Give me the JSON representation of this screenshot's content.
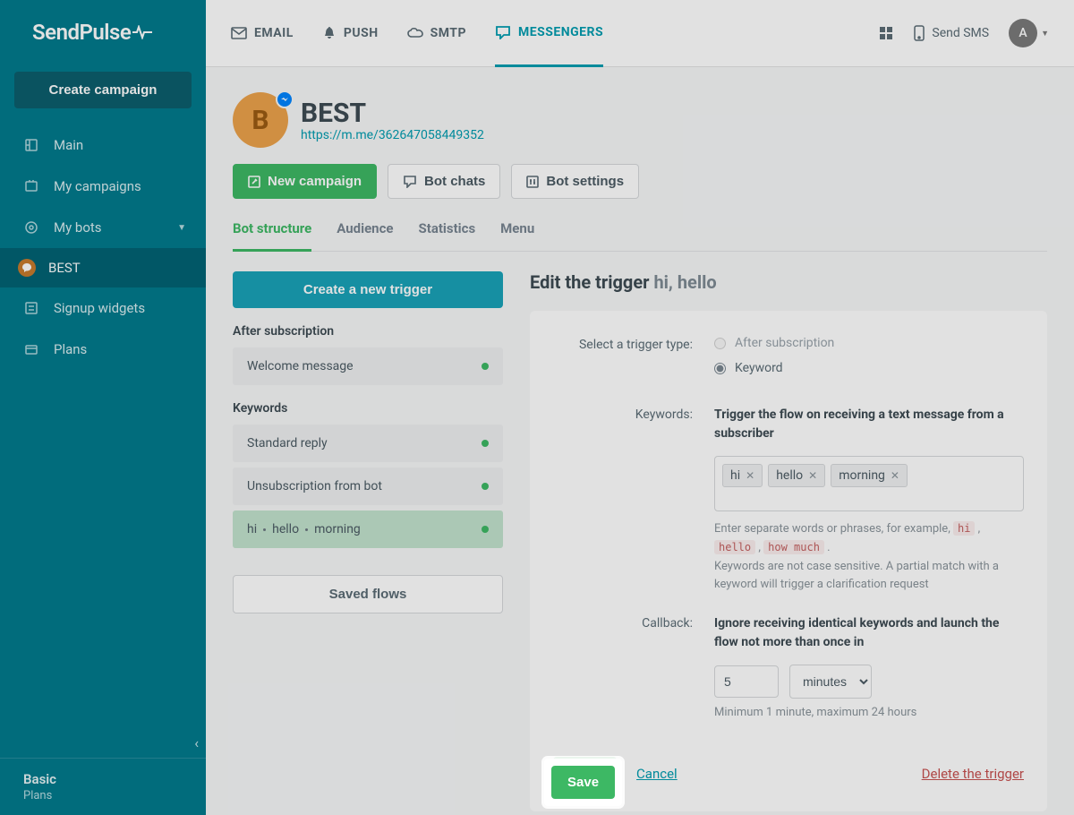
{
  "brand": "SendPulse",
  "sidebar": {
    "create_campaign": "Create campaign",
    "items": [
      {
        "label": "Main"
      },
      {
        "label": "My campaigns"
      },
      {
        "label": "My bots"
      },
      {
        "label": "BEST"
      },
      {
        "label": "Signup widgets"
      },
      {
        "label": "Plans"
      }
    ],
    "footer": {
      "plan": "Basic",
      "plans_link": "Plans"
    }
  },
  "topbar": {
    "tabs": [
      {
        "label": "EMAIL"
      },
      {
        "label": "PUSH"
      },
      {
        "label": "SMTP"
      },
      {
        "label": "MESSENGERS"
      }
    ],
    "send_sms": "Send SMS",
    "avatar": "A"
  },
  "page": {
    "title": "BEST",
    "avatar_letter": "B",
    "link": "https://m.me/362647058449352",
    "actions": {
      "new_campaign": "New campaign",
      "bot_chats": "Bot chats",
      "bot_settings": "Bot settings"
    },
    "subtabs": [
      "Bot structure",
      "Audience",
      "Statistics",
      "Menu"
    ]
  },
  "triggers": {
    "create_btn": "Create a new trigger",
    "after_subscription_label": "After subscription",
    "after_subscription_items": [
      {
        "label": "Welcome message"
      }
    ],
    "keywords_label": "Keywords",
    "keywords_items": [
      {
        "label": "Standard reply"
      },
      {
        "label": "Unsubscription from bot"
      },
      {
        "kw": [
          "hi",
          "hello",
          "morning"
        ]
      }
    ],
    "saved_flows": "Saved flows"
  },
  "editor": {
    "heading_prefix": "Edit the trigger ",
    "heading_kw": "hi, hello",
    "field_trigger_type": "Select a trigger type:",
    "radio_after": "After subscription",
    "radio_keyword": "Keyword",
    "field_keywords": "Keywords:",
    "keywords_desc": "Trigger the flow on receiving a text message from a subscriber",
    "chips": [
      "hi",
      "hello",
      "morning"
    ],
    "hint_prefix": "Enter separate words or phrases, for example, ",
    "hint_ex1": "hi",
    "hint_ex2": "hello",
    "hint_ex3": "how much",
    "hint_rest": "Keywords are not case sensitive. A partial match with a keyword will trigger a clarification request",
    "field_callback": "Callback:",
    "callback_desc": "Ignore receiving identical keywords and launch the flow not more than once in",
    "callback_value": "5",
    "callback_unit": "minutes",
    "callback_hint": "Minimum 1 minute, maximum 24 hours",
    "save": "Save",
    "cancel": "Cancel",
    "delete": "Delete the trigger"
  }
}
